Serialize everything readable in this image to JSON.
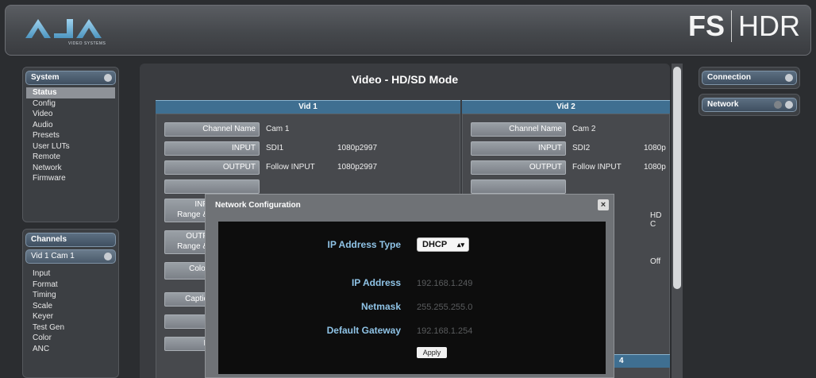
{
  "header": {
    "logo_text": "AJA",
    "logo_subtext": "VIDEO SYSTEMS",
    "product_name_bold": "FS",
    "product_name_light": "HDR"
  },
  "sidebar_left": {
    "system": {
      "title": "System",
      "items": [
        "Status",
        "Config",
        "Video",
        "Audio",
        "Presets",
        "User LUTs",
        "Remote",
        "Network",
        "Firmware"
      ],
      "selected": "Status"
    },
    "channels": {
      "title": "Channels",
      "dropdown_value": "Vid 1 Cam 1",
      "items": [
        "Input",
        "Format",
        "Timing",
        "Scale",
        "Keyer",
        "Test Gen",
        "Color",
        "ANC"
      ]
    }
  },
  "main": {
    "title": "Video - HD/SD Mode",
    "columns": [
      {
        "header": "Vid 1",
        "rows": [
          {
            "button": "Channel Name",
            "value": "Cam 1",
            "extra": ""
          },
          {
            "button": "INPUT",
            "value": "SDI1",
            "extra": "1080p2997"
          },
          {
            "button": "OUTPUT",
            "value": "Follow INPUT",
            "extra": "1080p2997"
          }
        ],
        "partial_buttons": [
          "INP",
          "Range &",
          "OUTP",
          "Range &",
          "Color",
          "Captio",
          "L"
        ]
      },
      {
        "header": "Vid 2",
        "rows": [
          {
            "button": "Channel Name",
            "value": "Cam 2",
            "extra": ""
          },
          {
            "button": "INPUT",
            "value": "SDI2",
            "extra": "1080p"
          },
          {
            "button": "OUTPUT",
            "value": "Follow INPUT",
            "extra": "1080p"
          }
        ],
        "partial_values": [
          "HD C",
          "Off"
        ],
        "partial_header": "4"
      }
    ]
  },
  "sidebar_right": {
    "connection_title": "Connection",
    "network_title": "Network"
  },
  "modal": {
    "title": "Network Configuration",
    "close_glyph": "×",
    "ip_type_label": "IP Address Type",
    "ip_type_value": "DHCP",
    "ip_address_label": "IP Address",
    "ip_address_value": "192.168.1.249",
    "netmask_label": "Netmask",
    "netmask_value": "255.255.255.0",
    "gateway_label": "Default Gateway",
    "gateway_value": "192.168.1.254",
    "apply_label": "Apply"
  },
  "colors": {
    "accent_blue": "#3f6f91",
    "label_blue": "#8fc3e6",
    "background": "#2b2d30"
  }
}
